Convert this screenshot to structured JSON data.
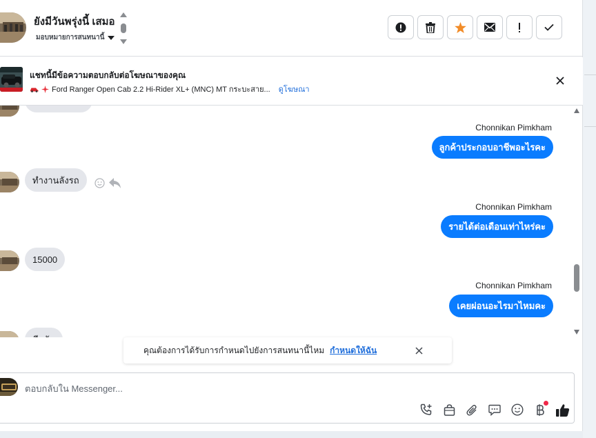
{
  "header": {
    "thread_title": "ยังมีวันพรุ่งนี้ เสมอ",
    "assign_label": "มอบหมายการสนทนานี้"
  },
  "ad": {
    "title": "แชทนี้มีข้อความตอบกลับต่อโฆษณาของคุณ",
    "subtitle": "Ford Ranger Open Cab 2.2 Hi-Rider XL+ (MNC) MT กระบะสาย...",
    "link": "ดูโฆษณา"
  },
  "messages": [
    {
      "dir": "in",
      "text": ""
    },
    {
      "dir": "out",
      "sender": "Chonnikan Pimkham",
      "text": "ลูกค้าประกอบอาชีพอะไรคะ"
    },
    {
      "dir": "in",
      "text": "ทำงานลังรถ"
    },
    {
      "dir": "out",
      "sender": "Chonnikan Pimkham",
      "text": "รายได้ต่อเดือนเท่าไหร่คะ"
    },
    {
      "dir": "in",
      "text": "15000"
    },
    {
      "dir": "out",
      "sender": "Chonnikan Pimkham",
      "text": "เคยผ่อนอะไรมาไหมคะ"
    },
    {
      "dir": "in",
      "text": "มีครับ"
    }
  ],
  "notice": {
    "text": "คุณต้องการได้รับการกำหนดไปยังการสนทนานี้ไหม",
    "link": "กำหนดให้ฉัน"
  },
  "composer": {
    "placeholder": "ตอบกลับใน Messenger..."
  },
  "icons": {
    "actions": [
      "alert-circle-icon",
      "trash-icon",
      "star-icon",
      "mail-icon",
      "exclamation-icon",
      "check-icon"
    ],
    "tools": [
      "phone-plus-icon",
      "shopping-bag-icon",
      "paperclip-icon",
      "message-icon",
      "emoji-icon",
      "baht-icon",
      "thumbs-up-icon"
    ]
  },
  "colors": {
    "accent": "#0a7cff",
    "star": "#f28c28",
    "link": "#216fdb",
    "incoming_bubble": "#e4e6eb"
  }
}
